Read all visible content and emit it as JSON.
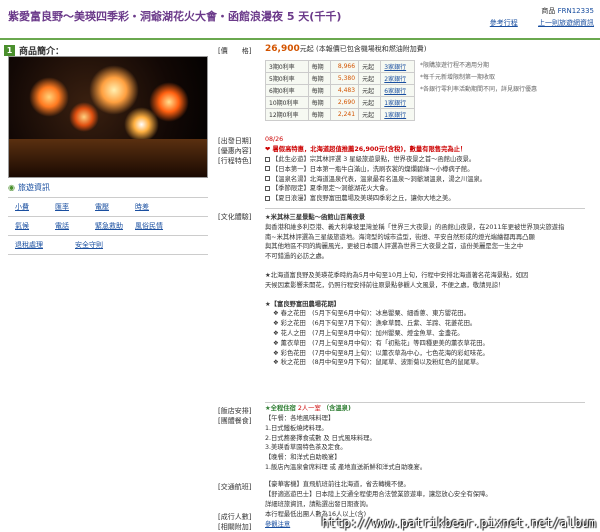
{
  "header": {
    "title": "紫愛富良野～美瑛四季彩・洞爺湖花火大會・函館浪漫夜 5 天(千千)",
    "code_label": "商品",
    "code": "FRN12335",
    "links": [
      "參考行程",
      "上一則旅遊網資訊"
    ]
  },
  "section": {
    "num": "1",
    "title": "商品簡介："
  },
  "tour_info": "旅遊資訊",
  "link_grid": [
    [
      "小費",
      "匯率",
      "電壓",
      "時差"
    ],
    [
      "氣候",
      "電話",
      "緊急救助",
      "風俗民情"
    ],
    [
      "退稅處理",
      "安全守則",
      "",
      ""
    ]
  ],
  "labels": {
    "price": "價　　格",
    "depart": "出發日期",
    "promo": "優惠內容",
    "features": "行程特色",
    "culture": "文化體驗",
    "hotel": "飯店安排",
    "meal": "團體餐食",
    "transport": "交通航班",
    "group": "成行人數",
    "tips": "相關附加"
  },
  "price": {
    "amount": "26,900",
    "unit": "元起",
    "note": "(本報價已包含機場稅和燃油附加費)"
  },
  "price_table": [
    {
      "period": "3期0利率",
      "each": "每期",
      "value": "8,966",
      "unit": "元起",
      "link": "3家銀行"
    },
    {
      "period": "5期0利率",
      "each": "每期",
      "value": "5,380",
      "unit": "元起",
      "link": "2家銀行"
    },
    {
      "period": "6期0利率",
      "each": "每期",
      "value": "4,483",
      "unit": "元起",
      "link": "6家銀行"
    },
    {
      "period": "10期0利率",
      "each": "每期",
      "value": "2,690",
      "unit": "元起",
      "link": "1家銀行"
    },
    {
      "period": "12期0利率",
      "each": "每期",
      "value": "2,241",
      "unit": "元起",
      "link": "1家銀行"
    }
  ],
  "notes": [
    "*限購旅遊行程不適用分期",
    "*每千元新增限制第一期收取",
    "*各銀行零利率活動期間不同，詳見銀行優惠"
  ],
  "depart_date": "08/26",
  "promo": "暑假高特惠，北海道超值推薦26,900元(含稅)，數量有限售完為止！",
  "features": [
    "【此生必遊】宗其林評選 3 星級旅遊景點，世界夜景之首～函館山夜景。",
    "【日本第一】日本第一瓶牛白滿山，洗刷衣裳的燦爛碧綠～小樽病子館。",
    "【溫泉名湯】北海道溫泉代表，溫泉最有名溫泉～洞爺湖溫泉，湯之川溫泉。",
    "【季節限定】夏季限定～洞爺湖花火大會。",
    "【夏日浪漫】富良野富田農場及美瑛四季彩之丘，讓你大地之美。"
  ],
  "culture": {
    "heading1": "★米其林三星景點～函館山百萬夜景",
    "para1": [
      "與香港和維多利亞港、義大利拿坡里灣並稱「世界三大夜景」的函館山夜景，在2011年更被世界頂尖旅遊指",
      "南~米其林評選為三星級旅遊地。海湾型的城市造型，街燈、平安自然形成的燈光端繪都再再凸顯",
      "與其他地區不同的絢麗風光，更被日本國人評選為世界三大夜景之首，這份美麗是您一生之中",
      "不可錯過的必訪之處。"
    ],
    "para2": [
      "★北海道富良野及美瑛花季時約為5月中旬至10月上旬，行程中安排北海道著名花海景點，如因",
      "天候因素影響未開花，仍照行程安排前往原景點參觀人文風景，不便之處，敬請見諒！"
    ],
    "heading2": "★【富良野富田農場花期】",
    "flowers": [
      "春之花田　(5月下旬至6月中旬)：冰島罌粟、細香蔥、東方罌花田。",
      "彩之花田　(6月下旬至7月下旬)：漁傘草開、丘紫、羊蹄、花菱花田。",
      "花人之田　(7月上旬至8月中旬)：加州罌粟、燈金魚草、金盞花。",
      "薰衣草田　(7月上旬至8月中旬)：有「初點花」等四種更美的薰衣草花田。",
      "彩色花田　(7月中旬至8月上旬)：以薰衣草為中心，七色花海的彩虹味花。",
      "秋之花田　(8月中旬至9月下旬)：鼠尾草、波斯菊以及粉紅色的鼠尾草。"
    ]
  },
  "hotel": {
    "prefix": "★全程住宿",
    "highlight": "2人一室",
    "suffix": "（含溫泉)"
  },
  "meals": [
    "【午餐：各地風味料理】",
    "1.日式鐵板燒烤料理。",
    "2.日式蕎麥擇食或數 及 日式風味料理。",
    "3.美瑛香草園特色茶及定食。",
    "【晚餐：和洋式自助晚宴】",
    "1.飯店內溫泉會席料理 或 產地直送新鮮和洋式自助晚宴。"
  ],
  "transport": [
    "【豪華客機】直飛航班前往北海道，省去轉機不便。",
    "【舒適巡遊巴士】日本陸上交通全程使用合法營業旅遊車，讓您放心安全有保障。",
    "詳細班旅資訊，請點選出發日期查詢。"
  ],
  "group": "本行程最低出團人數為16人以上(含)",
  "tips_link": "參觀注意",
  "watermark": "http://www.patrikbear.pixnet.net/album"
}
